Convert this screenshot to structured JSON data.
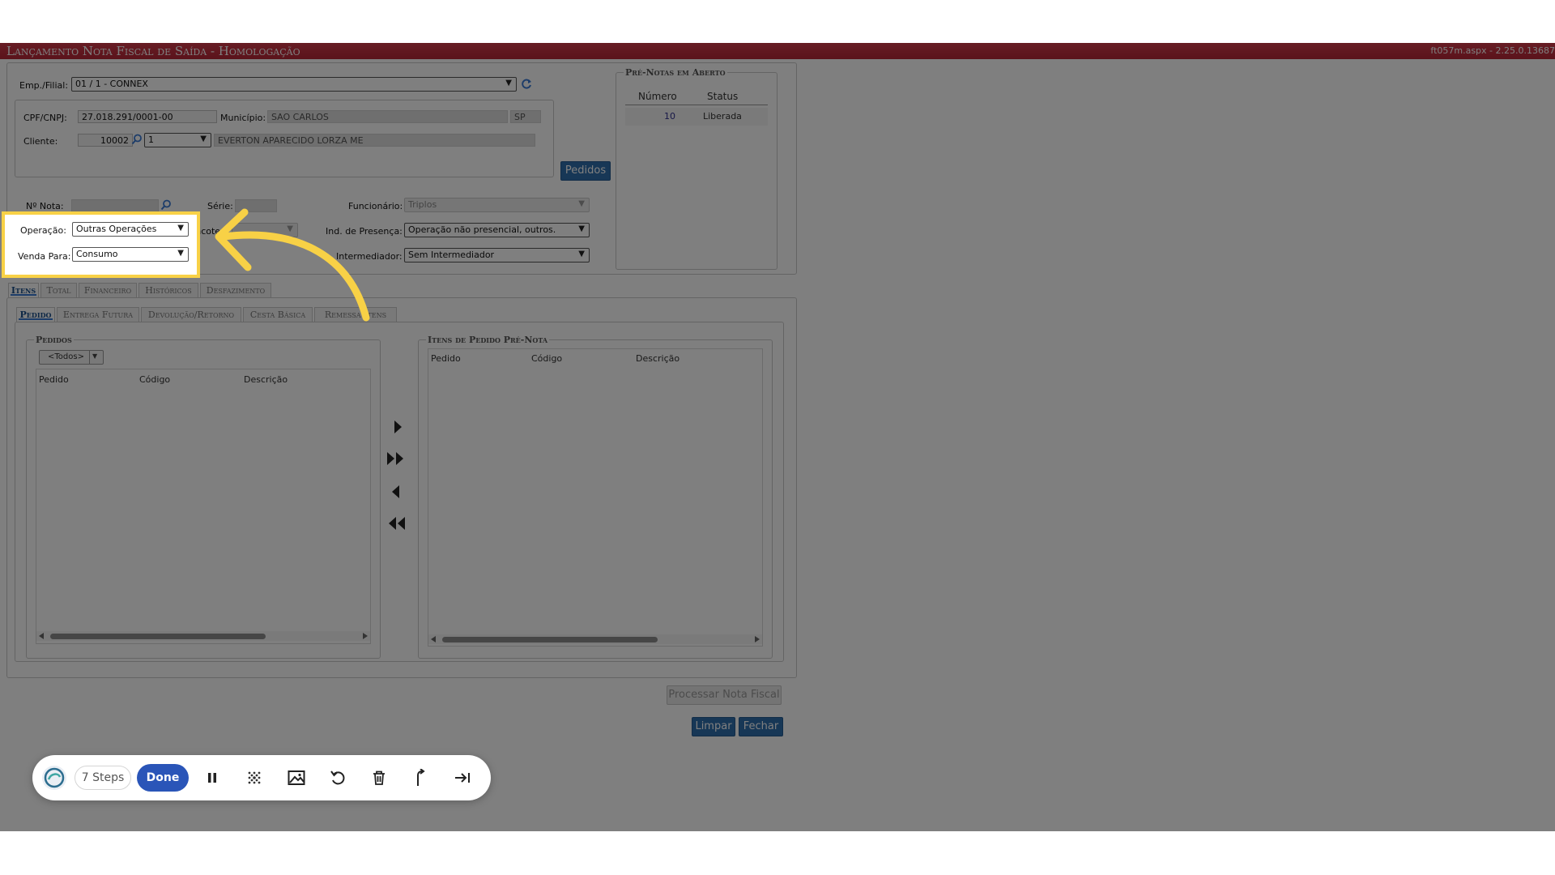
{
  "title": "Lançamento Nota Fiscal de Saída  - Homologação",
  "version": "ft057m.aspx - 2.25.0.13687",
  "header": {
    "empresa_label": "Emp./Filial:",
    "empresa_value": "01 / 1 - CONNEX",
    "cpf_label": "CPF/CNPJ:",
    "cpf_value": "27.018.291/0001-00",
    "municipio_label": "Município:",
    "municipio_value": "SAO CARLOS",
    "uf_value": "SP",
    "cliente_label": "Cliente:",
    "cliente_code": "10002",
    "cliente_seq": "1",
    "cliente_name": "EVERTON APARECIDO LORZA ME",
    "pedidos_button": "Pedidos"
  },
  "prenotas": {
    "legend": "Pré-Notas em Aberto",
    "columns": [
      "Número",
      "Status"
    ],
    "rows": [
      {
        "numero": "10",
        "status": "Liberada"
      }
    ]
  },
  "form": {
    "nota_label": "Nº Nota:",
    "serie_label": "Série:",
    "funcionario_label": "Funcionário:",
    "funcionario_value": "Triplos",
    "operacao_label": "Operação:",
    "operacao_value": "Outras Operações",
    "incoterm_label": "Incote",
    "presenca_label": "Ind. de Presença:",
    "presenca_value": "Operação não presencial, outros.",
    "venda_label": "Venda Para:",
    "venda_value": "Consumo",
    "intermediador_label": "Intermediador:",
    "intermediador_value": "Sem Intermediador"
  },
  "main_tabs": [
    "Itens",
    "Total",
    "Financeiro",
    "Históricos",
    "Desfazimento"
  ],
  "sub_tabs": [
    "Pedido",
    "Entrega Futura",
    "Devolução/Retorno",
    "Cesta Básica",
    "Remessa Itens"
  ],
  "pedidos_panel": {
    "legend": "Pedidos",
    "filter_value": "<Todos>",
    "columns": [
      "Pedido",
      "Código",
      "Descrição"
    ]
  },
  "itens_panel": {
    "legend": "Itens de Pedido Pré-Nota",
    "columns": [
      "Pedido",
      "Código",
      "Descrição"
    ]
  },
  "actions": {
    "processar": "Processar Nota Fiscal",
    "limpar": "Limpar",
    "fechar": "Fechar"
  },
  "toolbar": {
    "steps_label": "7 Steps",
    "done_label": "Done"
  },
  "colors": {
    "title_bar": "#c4303f",
    "primary_button": "#2f6fad",
    "highlight": "#f8d146",
    "done_button": "#2a55b8"
  }
}
